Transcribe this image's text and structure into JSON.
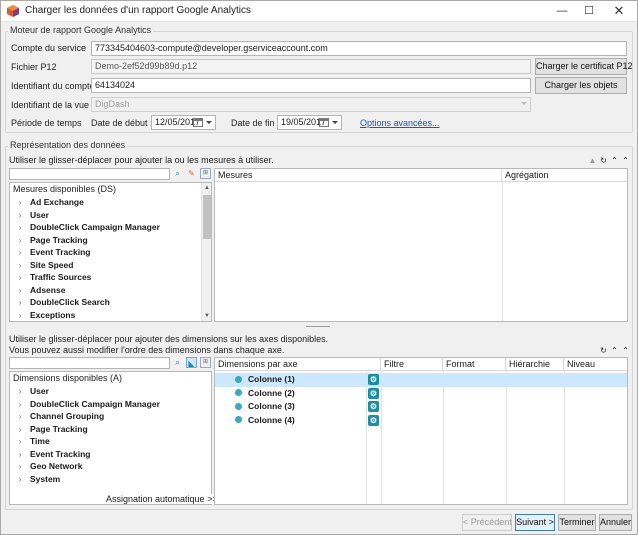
{
  "window": {
    "title": "Charger les données d'un rapport Google Analytics",
    "minimize": "—",
    "maximize": "☐",
    "close": "✕"
  },
  "engine": {
    "legend": "Moteur de rapport Google Analytics",
    "service_account_label": "Compte du service",
    "service_account_value": "773345404603-compute@developer.gserviceaccount.com",
    "p12_label": "Fichier P12",
    "p12_value": "Demo-2ef52d99b89d.p12",
    "p12_button": "Charger le certificat P12",
    "account_id_label": "Identifiant du compte",
    "account_id_value": "64134024",
    "load_objects_button": "Charger les objets",
    "view_id_label": "Identifiant de la vue",
    "view_id_value": "DigDash",
    "period_label": "Période de temps",
    "start_label": "Date de début :",
    "start_value": "12/05/2017",
    "end_label": "Date de fin :",
    "end_value": "19/05/2017",
    "advanced_link": "Options avancées..."
  },
  "representation": {
    "legend": "Représentation des données",
    "measures_hint": "Utiliser le glisser-déplacer pour ajouter la ou les mesures à utiliser.",
    "measures_tree_header": "Mesures disponibles (DS)",
    "measures_items": [
      "Ad Exchange",
      "User",
      "DoubleClick Campaign Manager",
      "Page Tracking",
      "Event Tracking",
      "Site Speed",
      "Traffic Sources",
      "Adsense",
      "DoubleClick Search",
      "Exceptions"
    ],
    "measures_col": "Mesures",
    "aggregation_col": "Agrégation",
    "dims_hint1": "Utiliser le glisser-déplacer pour ajouter des dimensions sur les axes disponibles.",
    "dims_hint2": "Vous pouvez aussi modifier l'ordre des dimensions dans chaque axe.",
    "dims_tree_header": "Dimensions disponibles (A)",
    "dims_items": [
      "User",
      "DoubleClick Campaign Manager",
      "Channel Grouping",
      "Page Tracking",
      "Time",
      "Event Tracking",
      "Geo Network",
      "System"
    ],
    "auto_assign": "Assignation automatique >>",
    "dims_col_axis": "Dimensions par axe",
    "dims_col_filter": "Filtre",
    "dims_col_format": "Format",
    "dims_col_hierarchy": "Hiérarchie",
    "dims_col_level": "Niveau",
    "axes": [
      "Colonne (1)",
      "Colonne (2)",
      "Colonne (3)",
      "Colonne (4)"
    ]
  },
  "footer": {
    "prev": "< Précédent",
    "next": "Suivant >",
    "finish": "Terminer",
    "cancel": "Annuler"
  },
  "icons": {
    "search": "magnifier-icon",
    "clear": "eraser-icon",
    "expand": "expand-icon",
    "sort": "sort-icon",
    "refresh": "refresh-icon",
    "collapse": "collapse-icon",
    "gear": "gear-icon"
  },
  "colors": {
    "selection": "#cce8ff",
    "link": "#1a56c4",
    "accent": "#1b8ea6"
  }
}
